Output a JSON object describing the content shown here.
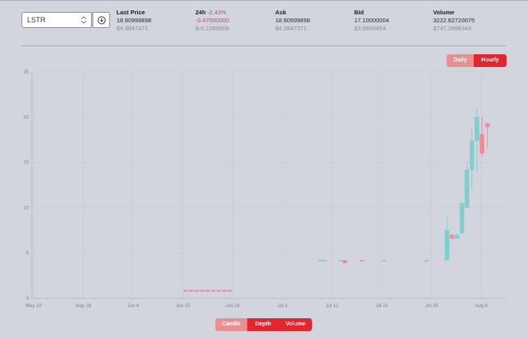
{
  "selector": {
    "value": "LSTR"
  },
  "stats": [
    {
      "label": "Last Price",
      "change": "",
      "value": "18.90999898",
      "sub": "$4.3847371",
      "red": false
    },
    {
      "label": "24h",
      "change": "-2.43%",
      "value": "-0.47000000",
      "sub": "$-0.1089808",
      "red": true
    },
    {
      "label": "Ask",
      "change": "",
      "value": "18.90999898",
      "sub": "$4.3847371",
      "red": false
    },
    {
      "label": "Bid",
      "change": "",
      "value": "17.10000004",
      "sub": "$3.9650454",
      "red": false
    },
    {
      "label": "Volume",
      "change": "",
      "value": "3222.82720075",
      "sub": "$747.2898343",
      "red": false
    }
  ],
  "period_toggle": {
    "daily": "Daily",
    "hourly": "Hourly",
    "active": "Hourly"
  },
  "view_toggle": {
    "candle": "Candle",
    "depth": "Depth",
    "volume": "Volume",
    "active": "Depth"
  },
  "colors": {
    "up": "#7fcfcf",
    "down": "#f08a98",
    "accent": "#e0262e",
    "accent_light": "#e88f92"
  },
  "chart_data": {
    "type": "candlestick",
    "x_ticks": [
      "May 19",
      "May 28",
      "Jun 6",
      "Jun 15",
      "Jun 24",
      "Jul 3",
      "Jul 12",
      "Jul 21",
      "Jul 30",
      "Aug 8"
    ],
    "y_ticks": [
      0,
      5,
      10,
      15,
      20,
      25
    ],
    "ylim": [
      0,
      25
    ],
    "xlim": [
      -0.3,
      85.4
    ],
    "grid": true,
    "candles": [
      {
        "day": 27.5,
        "o": 0.9,
        "h": 0.9,
        "l": 0.75,
        "c": 0.75
      },
      {
        "day": 28.5,
        "o": 0.9,
        "h": 0.9,
        "l": 0.75,
        "c": 0.75
      },
      {
        "day": 29.5,
        "o": 0.9,
        "h": 0.9,
        "l": 0.75,
        "c": 0.75
      },
      {
        "day": 30.5,
        "o": 0.9,
        "h": 0.9,
        "l": 0.75,
        "c": 0.75
      },
      {
        "day": 31.5,
        "o": 0.9,
        "h": 0.9,
        "l": 0.75,
        "c": 0.75
      },
      {
        "day": 32.5,
        "o": 0.9,
        "h": 0.9,
        "l": 0.75,
        "c": 0.75
      },
      {
        "day": 33.5,
        "o": 0.9,
        "h": 0.9,
        "l": 0.75,
        "c": 0.75
      },
      {
        "day": 34.5,
        "o": 0.9,
        "h": 0.9,
        "l": 0.75,
        "c": 0.75
      },
      {
        "day": 35.5,
        "o": 0.9,
        "h": 0.9,
        "l": 0.75,
        "c": 0.75
      },
      {
        "day": 51.9,
        "o": 4.2,
        "h": 4.2,
        "l": 4.2,
        "c": 4.2
      },
      {
        "day": 52.6,
        "o": 4.2,
        "h": 4.2,
        "l": 4.2,
        "c": 4.2
      },
      {
        "day": 55.6,
        "o": 4.2,
        "h": 4.2,
        "l": 4.2,
        "c": 4.2
      },
      {
        "day": 56.3,
        "o": 4.2,
        "h": 4.2,
        "l": 3.9,
        "c": 3.9
      },
      {
        "day": 59.4,
        "o": 4.2,
        "h": 4.2,
        "l": 4.1,
        "c": 4.1
      },
      {
        "day": 63.4,
        "o": 4.2,
        "h": 4.2,
        "l": 4.2,
        "c": 4.2
      },
      {
        "day": 71.1,
        "o": 4.1,
        "h": 4.3,
        "l": 4.0,
        "c": 4.2
      },
      {
        "day": 74.8,
        "o": 4.2,
        "h": 9.0,
        "l": 4.2,
        "c": 7.5
      },
      {
        "day": 75.7,
        "o": 7.0,
        "h": 7.0,
        "l": 6.5,
        "c": 6.6
      },
      {
        "day": 76.6,
        "o": 6.6,
        "h": 7.2,
        "l": 6.6,
        "c": 7.0
      },
      {
        "day": 77.5,
        "o": 7.2,
        "h": 10.5,
        "l": 7.2,
        "c": 10.5
      },
      {
        "day": 78.4,
        "o": 10.0,
        "h": 15.0,
        "l": 10.0,
        "c": 14.2
      },
      {
        "day": 79.3,
        "o": 14.2,
        "h": 18.7,
        "l": 12.0,
        "c": 17.4
      },
      {
        "day": 80.2,
        "o": 17.4,
        "h": 21.0,
        "l": 13.8,
        "c": 20.0
      },
      {
        "day": 81.1,
        "o": 18.1,
        "h": 20.0,
        "l": 15.6,
        "c": 16.0
      },
      {
        "day": 82.1,
        "o": 19.3,
        "h": 19.3,
        "l": 16.6,
        "c": 18.9
      }
    ]
  }
}
